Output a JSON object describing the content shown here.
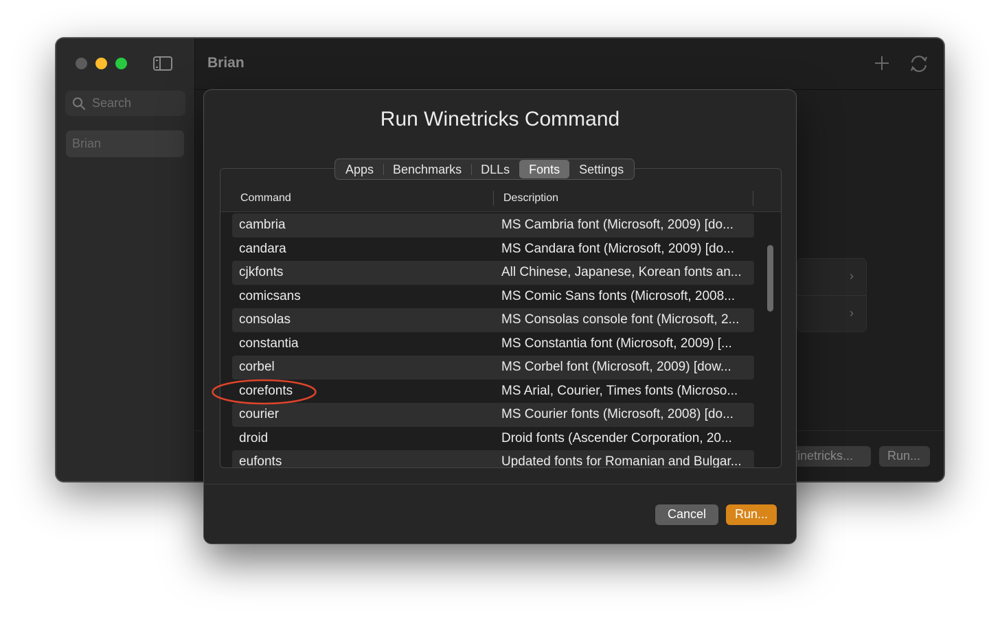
{
  "window": {
    "title": "Brian",
    "traffic_lights": [
      "gray",
      "yellow",
      "green"
    ]
  },
  "sidebar": {
    "search_placeholder": "Search",
    "items": [
      {
        "label": "Brian"
      }
    ]
  },
  "toolbar": {
    "icons": [
      "plus-icon",
      "refresh-icon"
    ]
  },
  "background_buttons": {
    "winetricks_label": "Winetricks...",
    "run_label": "Run..."
  },
  "sheet": {
    "title": "Run Winetricks Command",
    "tabs": [
      {
        "label": "Apps",
        "active": false
      },
      {
        "label": "Benchmarks",
        "active": false
      },
      {
        "label": "DLLs",
        "active": false
      },
      {
        "label": "Fonts",
        "active": true
      },
      {
        "label": "Settings",
        "active": false
      }
    ],
    "table": {
      "headers": {
        "command": "Command",
        "description": "Description"
      },
      "rows": [
        {
          "command": "cambria",
          "description": "MS Cambria font (Microsoft, 2009) [do..."
        },
        {
          "command": "candara",
          "description": "MS Candara font (Microsoft, 2009) [do..."
        },
        {
          "command": "cjkfonts",
          "description": "All Chinese, Japanese, Korean fonts an..."
        },
        {
          "command": "comicsans",
          "description": "MS Comic Sans fonts (Microsoft, 2008..."
        },
        {
          "command": "consolas",
          "description": "MS Consolas console font (Microsoft, 2..."
        },
        {
          "command": "constantia",
          "description": "MS Constantia font (Microsoft, 2009) [..."
        },
        {
          "command": "corbel",
          "description": "MS Corbel font (Microsoft, 2009) [dow..."
        },
        {
          "command": "corefonts",
          "description": "MS Arial, Courier, Times fonts (Microso..."
        },
        {
          "command": "courier",
          "description": "MS Courier fonts (Microsoft, 2008) [do..."
        },
        {
          "command": "droid",
          "description": "Droid fonts (Ascender Corporation, 20..."
        },
        {
          "command": "eufonts",
          "description": "Updated fonts for Romanian and Bulgar..."
        }
      ]
    },
    "buttons": {
      "cancel_label": "Cancel",
      "run_label": "Run..."
    },
    "colors": {
      "accent": "#d8851a",
      "highlight_annotation": "#e0442a"
    }
  }
}
